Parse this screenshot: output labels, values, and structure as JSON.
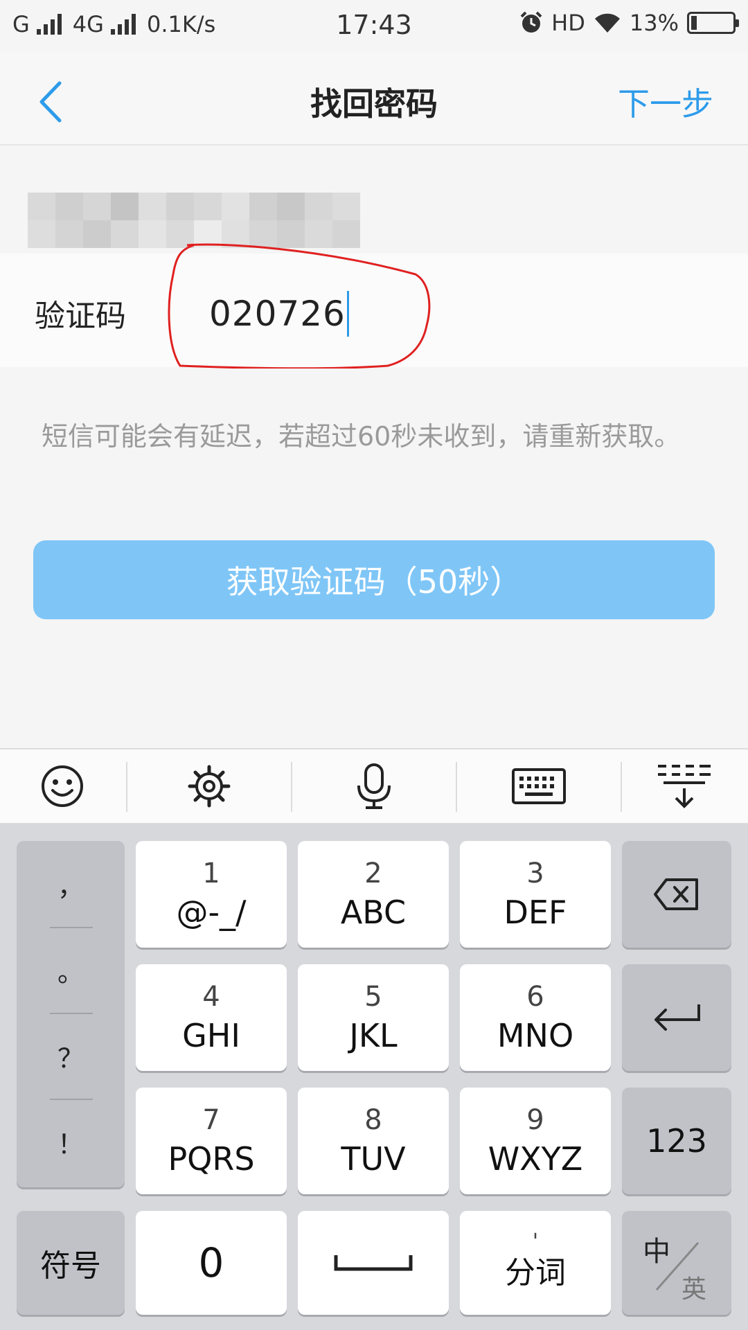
{
  "status_bar": {
    "carrier1": "G",
    "network": "4G",
    "speed": "0.1K/s",
    "time": "17:43",
    "hd": "HD",
    "battery": "13%"
  },
  "header": {
    "title": "找回密码",
    "next_label": "下一步"
  },
  "form": {
    "code_label": "验证码",
    "code_value": "020726",
    "hint": "短信可能会有延迟，若超过60秒未收到，请重新获取。",
    "get_code_button": "获取验证码（50秒）"
  },
  "keyboard": {
    "toolbar": [
      "emoji-icon",
      "settings-icon",
      "microphone-icon",
      "keyboard-icon",
      "collapse-keyboard-icon"
    ],
    "punctuation": [
      "，",
      "。",
      "？",
      "！"
    ],
    "keys": [
      {
        "num": "1",
        "letters": "@-_/"
      },
      {
        "num": "2",
        "letters": "ABC"
      },
      {
        "num": "3",
        "letters": "DEF"
      },
      {
        "num": "4",
        "letters": "GHI"
      },
      {
        "num": "5",
        "letters": "JKL"
      },
      {
        "num": "6",
        "letters": "MNO"
      },
      {
        "num": "7",
        "letters": "PQRS"
      },
      {
        "num": "8",
        "letters": "TUV"
      },
      {
        "num": "9",
        "letters": "WXYZ"
      }
    ],
    "symbol_key": "符号",
    "zero_key": "0",
    "segment_key_top": "'",
    "segment_key": "分词",
    "numbers_key": "123",
    "lang_key_top": "中",
    "lang_key_bottom": "英"
  },
  "colors": {
    "accent": "#2d9bea",
    "button_bg": "#7fc6f7",
    "annotation": "#e02020"
  }
}
